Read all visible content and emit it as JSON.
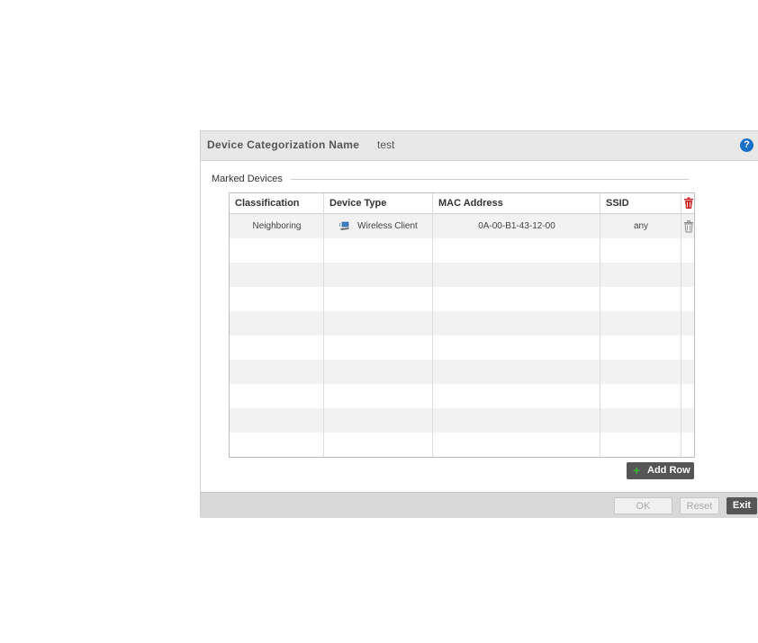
{
  "header": {
    "label": "Device Categorization Name",
    "value": "test",
    "help_icon": "question-circle-icon"
  },
  "group": {
    "title": "Marked Devices"
  },
  "table": {
    "columns": [
      "Classification",
      "Device Type",
      "MAC Address",
      "SSID"
    ],
    "rows": [
      {
        "classification": "Neighboring",
        "device_type": "Wireless Client",
        "device_icon": "wireless-client-icon",
        "mac": "0A-00-B1-43-12-00",
        "ssid": "any"
      }
    ]
  },
  "buttons": {
    "add_row": "Add Row",
    "ok": "OK",
    "reset": "Reset",
    "exit": "Exit"
  },
  "colors": {
    "accent_help": "#1a6fc9",
    "delete_red": "#cc2222",
    "add_green": "#3cb43c"
  }
}
